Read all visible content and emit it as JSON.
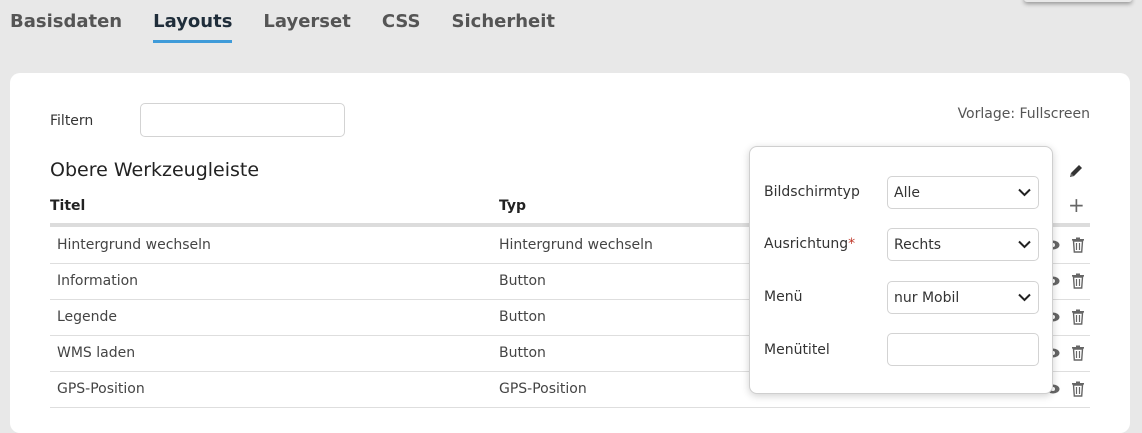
{
  "tabs": [
    {
      "label": "Basisdaten",
      "active": false
    },
    {
      "label": "Layouts",
      "active": true
    },
    {
      "label": "Layerset",
      "active": false
    },
    {
      "label": "CSS",
      "active": false
    },
    {
      "label": "Sicherheit",
      "active": false
    }
  ],
  "filter": {
    "label": "Filtern",
    "value": ""
  },
  "template_text": "Vorlage: Fullscreen",
  "section": {
    "title": "Obere Werkzeugleiste",
    "columns": {
      "title": "Titel",
      "type": "Typ"
    },
    "rows": [
      {
        "title": "Hintergrund wechseln",
        "type": "Hintergrund wechseln"
      },
      {
        "title": "Information",
        "type": "Button"
      },
      {
        "title": "Legende",
        "type": "Button"
      },
      {
        "title": "WMS laden",
        "type": "Button"
      },
      {
        "title": "GPS-Position",
        "type": "GPS-Position"
      }
    ]
  },
  "popover": {
    "fields": [
      {
        "label": "Bildschirmtyp",
        "required": false,
        "kind": "select",
        "value": "Alle"
      },
      {
        "label": "Ausrichtung",
        "required": true,
        "kind": "select",
        "value": "Rechts"
      },
      {
        "label": "Menü",
        "required": false,
        "kind": "select",
        "value": "nur Mobil"
      },
      {
        "label": "Menütitel",
        "required": false,
        "kind": "input",
        "value": ""
      }
    ],
    "required_mark": "*"
  },
  "colors": {
    "accent": "#3f9bd9",
    "required": "#c0392b"
  },
  "icons": [
    "pencil-icon",
    "plus-icon",
    "eye-icon",
    "trash-icon",
    "chevron-down-icon"
  ]
}
